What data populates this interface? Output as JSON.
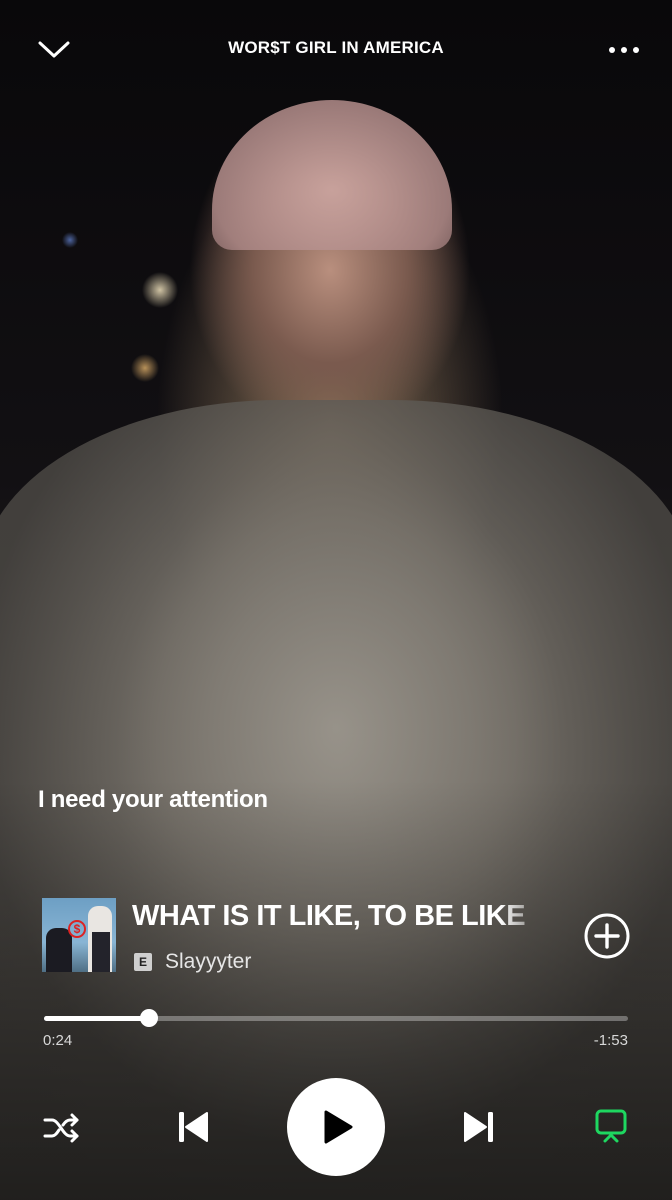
{
  "header": {
    "title": "WOR$T GIRL IN AMERICA",
    "collapse_icon": "chevron-down-icon",
    "menu_icon": "more-options-icon"
  },
  "lyrics": {
    "current_line": "I need your attention"
  },
  "track": {
    "title": "WHAT IS IT LIKE, TO BE LIKE",
    "explicit_badge": "E",
    "artist": "Slayyyter",
    "add_icon": "add-circle-icon"
  },
  "progress": {
    "elapsed": "0:24",
    "remaining": "-1:53",
    "fraction": 0.18
  },
  "controls": {
    "shuffle_icon": "shuffle-icon",
    "previous_icon": "skip-previous-icon",
    "play_icon": "play-icon",
    "next_icon": "skip-next-icon",
    "device_icon": "connect-device-icon",
    "accent_color": "#1ed760"
  }
}
